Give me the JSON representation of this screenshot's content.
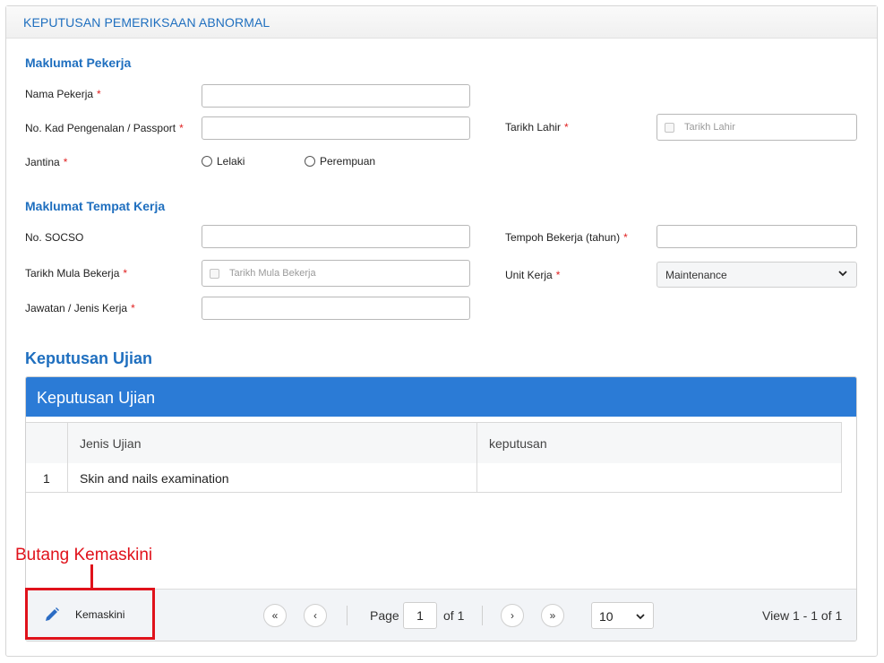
{
  "panel": {
    "title": "KEPUTUSAN PEMERIKSAAN ABNORMAL"
  },
  "worker_section": {
    "title": "Maklumat Pekerja",
    "name_label": "Nama Pekerja",
    "ic_label": "No. Kad Pengenalan / Passport",
    "dob_label": "Tarikh Lahir",
    "dob_placeholder": "Tarikh Lahir",
    "gender_label": "Jantina",
    "gender_male": "Lelaki",
    "gender_female": "Perempuan",
    "required_mark": "*"
  },
  "workplace_section": {
    "title": "Maklumat Tempat Kerja",
    "socso_label": "No. SOCSO",
    "tenure_label": "Tempoh Bekerja (tahun)",
    "start_date_label": "Tarikh Mula Bekerja",
    "start_date_placeholder": "Tarikh Mula Bekerja",
    "unit_label": "Unit Kerja",
    "unit_value": "Maintenance",
    "position_label": "Jawatan / Jenis Kerja"
  },
  "results": {
    "section_title": "Keputusan Ujian",
    "grid_caption": "Keputusan Ujian",
    "columns": [
      "Jenis Ujian",
      "keputusan"
    ],
    "rows": [
      {
        "num": "1",
        "test": "Skin and nails examination",
        "result": ""
      }
    ]
  },
  "pager": {
    "first": "«",
    "prev": "‹",
    "next": "›",
    "last": "»",
    "page_label": "Page",
    "page_value": "1",
    "of_label": "of 1",
    "page_size": "10",
    "view_text": "View 1 - 1 of 1",
    "edit_label": "Kemaskini"
  },
  "annotation": {
    "text": "Butang Kemaskini"
  },
  "colors": {
    "accent": "#1f6fbf",
    "grid_caption": "#2b7bd6",
    "annotation": "#e0121b",
    "required": "#e02020"
  },
  "icons": {
    "date": "calendar-icon",
    "select": "chevron-down-icon",
    "edit": "pencil-icon"
  }
}
